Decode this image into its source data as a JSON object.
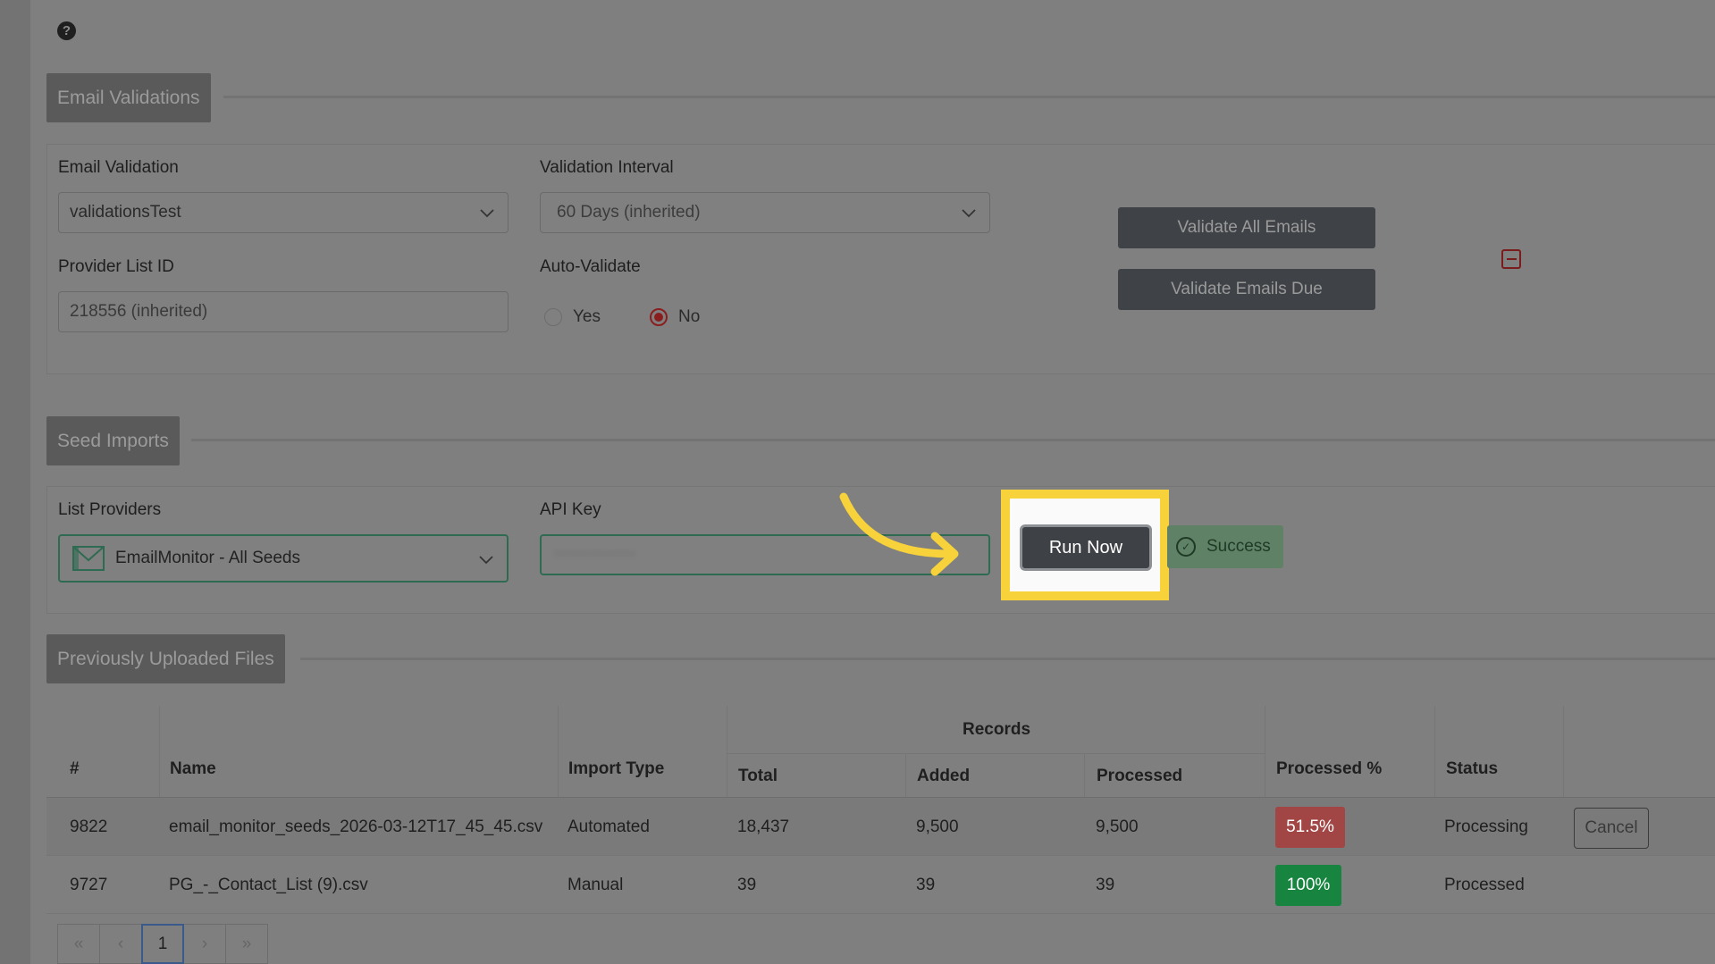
{
  "help": {
    "icon": "question-circle-icon",
    "glyph": "?"
  },
  "email_validations": {
    "section_title": "Email Validations",
    "email_validation_label": "Email Validation",
    "email_validation_value": "validationsTest",
    "validation_interval_label": "Validation Interval",
    "validation_interval_value": "60 Days (inherited)",
    "provider_list_id_label": "Provider List ID",
    "provider_list_id_value": "218556 (inherited)",
    "auto_validate_label": "Auto-Validate",
    "auto_validate_options": [
      "Yes",
      "No"
    ],
    "auto_validate_selected": "No",
    "validate_all_label": "Validate All Emails",
    "validate_due_label": "Validate Emails Due",
    "collapse_icon": "minus-square-icon"
  },
  "seed_imports": {
    "section_title": "Seed Imports",
    "list_providers_label": "List Providers",
    "list_providers_value": "EmailMonitor - All Seeds",
    "api_key_label": "API Key",
    "api_key_value": "••••••••••••",
    "run_now_label": "Run Now",
    "status_label": "Success",
    "highlight_color": "#f7d23a"
  },
  "uploaded_files": {
    "section_title": "Previously Uploaded Files",
    "headers": {
      "num": "#",
      "name": "Name",
      "import_type": "Import Type",
      "records": "Records",
      "total": "Total",
      "added": "Added",
      "processed": "Processed",
      "processed_pct": "Processed %",
      "status": "Status"
    },
    "rows": [
      {
        "num": "9822",
        "name": "email_monitor_seeds_2026-03-12T17_45_45.csv",
        "import_type": "Automated",
        "total": "18,437",
        "added": "9,500",
        "processed": "9,500",
        "processed_pct": "51.5%",
        "pct_color": "#a14545",
        "status": "Processing",
        "action": "Cancel"
      },
      {
        "num": "9727",
        "name": "PG_-_Contact_List (9).csv",
        "import_type": "Manual",
        "total": "39",
        "added": "39",
        "processed": "39",
        "processed_pct": "100%",
        "pct_color": "#17843f",
        "status": "Processed",
        "action": ""
      }
    ],
    "pagination": {
      "first": "«",
      "prev": "‹",
      "current": "1",
      "next": "›",
      "last": "»"
    }
  }
}
